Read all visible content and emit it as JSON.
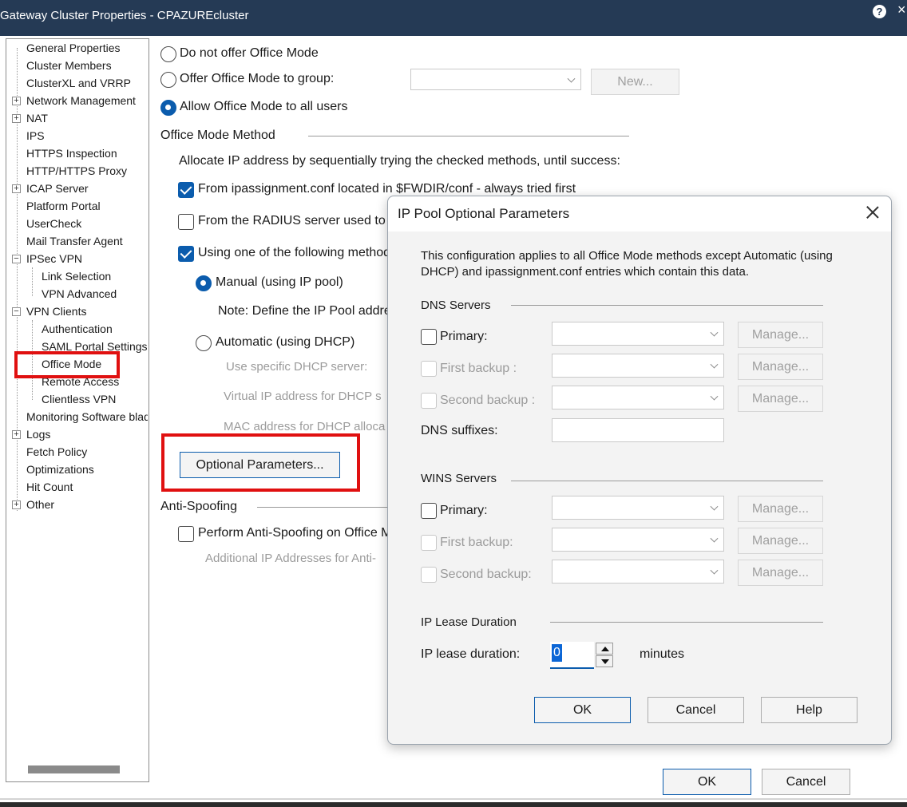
{
  "window": {
    "title": "Gateway Cluster Properties - CPAZUREcluster",
    "help_icon": "?",
    "close_icon": "×"
  },
  "tree": {
    "items": [
      {
        "label": "General Properties"
      },
      {
        "label": "Cluster Members"
      },
      {
        "label": "ClusterXL and VRRP"
      },
      {
        "label": "Network Management"
      },
      {
        "label": "NAT"
      },
      {
        "label": "IPS"
      },
      {
        "label": "HTTPS Inspection"
      },
      {
        "label": "HTTP/HTTPS Proxy"
      },
      {
        "label": "ICAP Server"
      },
      {
        "label": "Platform Portal"
      },
      {
        "label": "UserCheck"
      },
      {
        "label": "Mail Transfer Agent"
      },
      {
        "label": "IPSec VPN"
      },
      {
        "label": "Link Selection"
      },
      {
        "label": "VPN Advanced"
      },
      {
        "label": "VPN Clients"
      },
      {
        "label": "Authentication"
      },
      {
        "label": "SAML Portal Settings"
      },
      {
        "label": "Office Mode"
      },
      {
        "label": "Remote Access"
      },
      {
        "label": "Clientless VPN"
      },
      {
        "label": "Monitoring Software blad"
      },
      {
        "label": "Logs"
      },
      {
        "label": "Fetch Policy"
      },
      {
        "label": "Optimizations"
      },
      {
        "label": "Hit Count"
      },
      {
        "label": "Other"
      }
    ],
    "expander_plus": "+",
    "expander_minus": "−"
  },
  "main": {
    "radio_no_office_mode": "Do not offer Office Mode",
    "radio_offer_group": "Offer Office Mode to group:",
    "group_combo_value": "",
    "new_button": "New...",
    "radio_allow_all": "Allow Office Mode to all users",
    "method_section": "Office Mode Method",
    "allocate_text": "Allocate IP address by sequentially trying the checked methods, until success:",
    "check_ipassignment": "From ipassignment.conf located in $FWDIR/conf - always tried first",
    "check_radius": "From the RADIUS server used to",
    "check_using_methods": "Using one of the following method",
    "radio_manual": "Manual (using IP pool)",
    "note_text": "Note: Define the IP Pool addre",
    "radio_automatic": "Automatic (using DHCP)",
    "dim_dhcp_server": "Use specific DHCP server:",
    "dim_virtual_ip": "Virtual IP address for DHCP s",
    "dim_mac": "MAC address for DHCP alloca",
    "optional_params_button": "Optional Parameters...",
    "antispoof_section": "Anti-Spoofing",
    "check_antispoof": "Perform Anti-Spoofing on Office M",
    "dim_additional_ip": "Additional IP Addresses for Anti-",
    "ok_button": "OK",
    "cancel_button": "Cancel"
  },
  "dialog": {
    "title": "IP Pool Optional Parameters",
    "description": "This configuration applies to all Office Mode methods except Automatic (using DHCP) and ipassignment.conf entries which contain this data.",
    "dns_section": "DNS Servers",
    "dns_primary": "Primary:",
    "dns_first_backup": "First backup :",
    "dns_second_backup": "Second backup :",
    "dns_suffixes": "DNS suffixes:",
    "dns_suffixes_value": "",
    "wins_section": "WINS Servers",
    "wins_primary": "Primary:",
    "wins_first_backup": "First backup:",
    "wins_second_backup": "Second backup:",
    "manage_button": "Manage...",
    "lease_section": "IP Lease Duration",
    "lease_label": "IP lease duration:",
    "lease_value": "0",
    "lease_unit": "minutes",
    "ok_button": "OK",
    "cancel_button": "Cancel",
    "help_button": "Help"
  },
  "colors": {
    "titlebar": "#253a55",
    "accent": "#0b5cad",
    "highlight_box": "#e01010"
  }
}
